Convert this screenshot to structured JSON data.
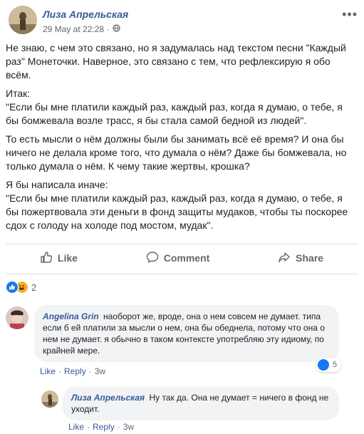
{
  "post": {
    "author": "Лиза Апрельская",
    "timestamp": "29 May at 22:28",
    "audience_icon": "globe-icon",
    "more_icon": "more-options-icon",
    "paragraphs": [
      "Не знаю, с чем это связано, но я задумалась над текстом песни \"Каждый раз\" Монеточки. Наверное, это связано с тем, что рефлексирую я обо всём.",
      "Итак:\n\"Если бы мне платили каждый раз, каждый раз, когда я думаю, о тебе, я бы бомжевала возле трасс, я бы стала самой бедной из людей\".",
      "То есть мысли о нём должны были бы занимать всё её время? И она бы ничего не делала кроме того, что думала о нём? Даже бы бомжевала, но только думала о нём. К чему такие жертвы, крошка?",
      "Я бы написала иначе:\n\"Если бы мне платили каждый раз, каждый раз, когда я думаю, о тебе, я бы пожертвовала эти деньги в фонд защиты мудаков, чтобы ты поскорее сдох с голоду на холоде под мостом, мудак\"."
    ]
  },
  "actions": {
    "like": "Like",
    "comment": "Comment",
    "share": "Share"
  },
  "reactions": {
    "icons": [
      "like-reaction-icon",
      "haha-reaction-icon"
    ],
    "count": "2"
  },
  "comments": [
    {
      "author": "Angelina Grin",
      "text": "наоборот же, вроде, она о нем совсем не думает. типа если б ей платили за мысли о нем, она бы обеднела, потому что она о нем не думает. я обычно в таком контексте употребляю эту идиому, по крайней мере.",
      "like": "Like",
      "reply": "Reply",
      "time": "3w",
      "reaction_count": "5"
    },
    {
      "author": "Лиза Апрельская",
      "text": "Ну так да. Она не думает = ничего в фонд не уходит.",
      "like": "Like",
      "reply": "Reply",
      "time": "3w"
    }
  ],
  "colors": {
    "link": "#385898",
    "like_blue": "#1877f2",
    "haha_yellow": "#f7b125",
    "bubble_bg": "#f2f3f5",
    "secondary_text": "#606770"
  }
}
